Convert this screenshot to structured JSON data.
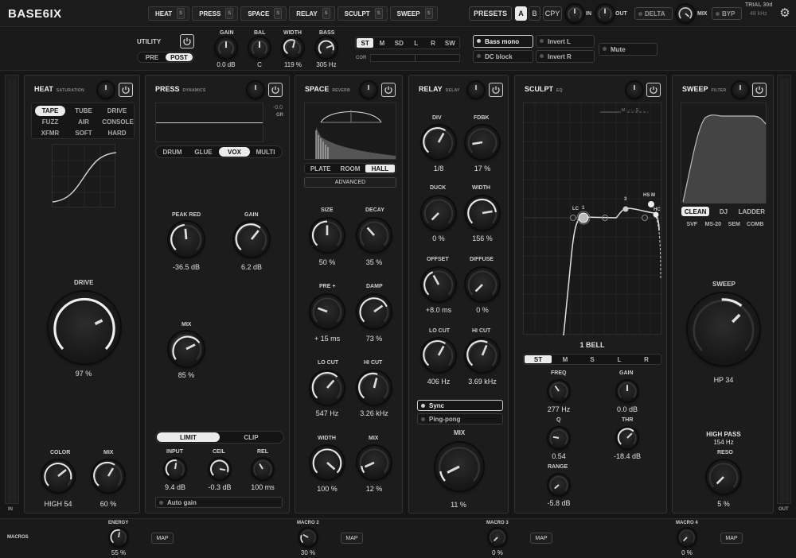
{
  "app": {
    "title": "BASE6IX",
    "trial": "TRIAL 30d",
    "sample_rate": "48 kHz"
  },
  "chain": [
    {
      "label": "HEAT",
      "solo": "S"
    },
    {
      "label": "PRESS",
      "solo": "S"
    },
    {
      "label": "SPACE",
      "solo": "S"
    },
    {
      "label": "RELAY",
      "solo": "S"
    },
    {
      "label": "SCULPT",
      "solo": "S"
    },
    {
      "label": "SWEEP",
      "solo": "S"
    }
  ],
  "top": {
    "presets": "PRESETS",
    "a": "A",
    "b": "B",
    "copy": "CPY",
    "in": "IN",
    "out": "OUT",
    "delta": "DELTA",
    "mix": "MIX",
    "bypass": "BYP"
  },
  "utility": {
    "title": "UTILITY",
    "pre": "PRE",
    "post": "POST",
    "gain_label": "GAIN",
    "gain": "0.0 dB",
    "bal_label": "BAL",
    "bal": "C",
    "width_label": "WIDTH",
    "width": "119 %",
    "bass_label": "BASS",
    "bass": "305 Hz",
    "modes": [
      "ST",
      "M",
      "SD",
      "L",
      "R",
      "SW"
    ],
    "cor": "COR",
    "bass_mono": "Bass mono",
    "dc_block": "DC block",
    "invert_l": "Invert L",
    "invert_r": "Invert R",
    "mute": "Mute"
  },
  "heat": {
    "title": "HEAT",
    "subtitle": "SATURATION",
    "types": [
      "TAPE",
      "TUBE",
      "DRIVE",
      "FUZZ",
      "AIR",
      "CONSOLE",
      "XFMR",
      "SOFT",
      "HARD"
    ],
    "drive_label": "DRIVE",
    "drive": "97 %",
    "drive_level": 97,
    "color_label": "COLOR",
    "color": "HIGH 54",
    "color_level": 77,
    "mix_label": "MIX",
    "mix": "60 %",
    "mix_level": 60
  },
  "press": {
    "title": "PRESS",
    "subtitle": "DYNAMICS",
    "gr": "GR",
    "gr_value": "-0.0",
    "modes": [
      "DRUM",
      "GLUE",
      "VOX",
      "MULTI"
    ],
    "peak_label": "PEAK RED",
    "peak": "-36.5 dB",
    "gain_label": "GAIN",
    "gain": "6.2 dB",
    "mix_label": "MIX",
    "mix": "85 %",
    "limit": "LIMIT",
    "clip": "CLIP",
    "input_label": "INPUT",
    "input": "9.4 dB",
    "ceil_label": "CEIL",
    "ceil": "-0.3 dB",
    "rel_label": "REL",
    "rel": "100 ms",
    "auto_gain": "Auto gain"
  },
  "space": {
    "title": "SPACE",
    "subtitle": "REVERB",
    "types": [
      "PLATE",
      "ROOM",
      "HALL"
    ],
    "advanced": "ADVANCED",
    "size_label": "SIZE",
    "size": "50 %",
    "decay_label": "DECAY",
    "decay": "35 %",
    "pre_label": "PRE +",
    "pre": "+ 15 ms",
    "damp_label": "DAMP",
    "damp": "73 %",
    "locut_label": "LO CUT",
    "locut": "547 Hz",
    "hicut_label": "HI CUT",
    "hicut": "3.26 kHz",
    "width_label": "WIDTH",
    "width": "100 %",
    "mix_label": "MIX",
    "mix": "12 %"
  },
  "relay": {
    "title": "RELAY",
    "subtitle": "DELAY",
    "div_label": "DIV",
    "div": "1/8",
    "fdbk_label": "FDBK",
    "fdbk": "17 %",
    "duck_label": "DUCK",
    "duck": "0 %",
    "width_label": "WIDTH",
    "width": "156 %",
    "offset_label": "OFFSET",
    "offset": "+8.0 ms",
    "diffuse_label": "DIFFUSE",
    "diffuse": "0 %",
    "locut_label": "LO CUT",
    "locut": "406 Hz",
    "hicut_label": "HI CUT",
    "hicut": "3.69 kHz",
    "sync": "Sync",
    "pingpong": "Ping-pong",
    "mix_label": "MIX",
    "mix": "11 %"
  },
  "sculpt": {
    "title": "SCULPT",
    "subtitle": "EQ",
    "legend": "M - - - - S",
    "band": "1   BELL",
    "modes": [
      "ST",
      "M",
      "S",
      "L",
      "R"
    ],
    "freq_label": "FREQ",
    "freq": "277 Hz",
    "gain_label": "GAIN",
    "gain": "0.0 dB",
    "q_label": "Q",
    "q": "0.54",
    "thr_label": "THR",
    "thr": "-18.4 dB",
    "range_label": "RANGE",
    "range": "-5.8 dB",
    "nodes": {
      "lc": "LC",
      "n1": "1",
      "n3": "3",
      "hsm": "HS M",
      "hc": "HC"
    }
  },
  "sweep": {
    "title": "SWEEP",
    "subtitle": "FILTER",
    "characters": [
      "CLEAN",
      "DJ",
      "LADDER"
    ],
    "models": [
      "SVF",
      "MS-20",
      "SEM",
      "COMB"
    ],
    "sweep_label": "SWEEP",
    "sweep": "HP 34",
    "mode": "HIGH PASS",
    "freq": "154 Hz",
    "reso_label": "RESO",
    "reso": "5 %"
  },
  "meters": {
    "in": "IN",
    "out": "OUT"
  },
  "macros": {
    "title": "MACROS",
    "map": "MAP",
    "items": [
      {
        "name": "ENERGY",
        "value": "55 %"
      },
      {
        "name": "MACRO 2",
        "value": "30 %"
      },
      {
        "name": "MACRO 3",
        "value": "0 %"
      },
      {
        "name": "MACRO 4",
        "value": "0 %"
      }
    ]
  },
  "colors": {
    "accent": "#ececec",
    "panel": "#1c1c1c",
    "bg": "#161616"
  }
}
